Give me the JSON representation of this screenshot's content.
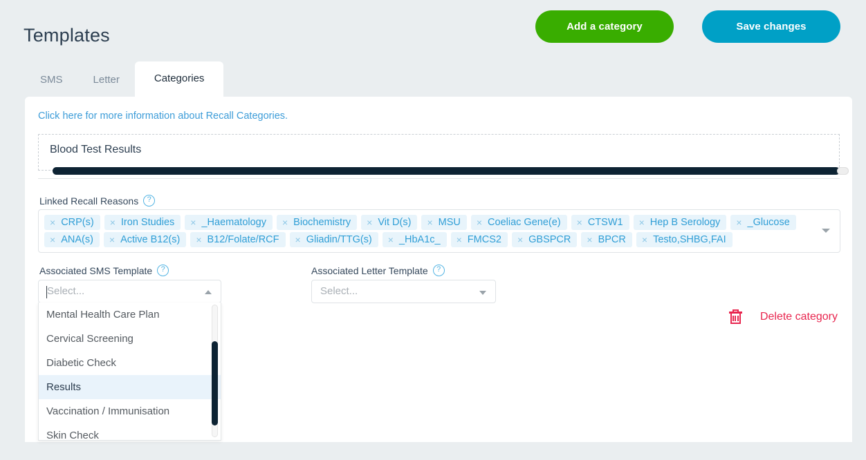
{
  "header": {
    "title": "Templates",
    "buttons": [
      {
        "label": "Add a category",
        "color": "#39ad00"
      },
      {
        "label": "Save changes",
        "color": "#00a0c6"
      }
    ]
  },
  "tabs": [
    {
      "label": "SMS",
      "active": false
    },
    {
      "label": "Letter",
      "active": false
    },
    {
      "label": "Categories",
      "active": true
    }
  ],
  "card": {
    "info_link": "Click here for more information about Recall Categories.",
    "category_name": "Blood Test Results",
    "recall": {
      "label": "Linked Recall Reasons",
      "help": "?",
      "chips": [
        "CRP(s)",
        "Iron Studies",
        "_Haematology",
        "Biochemistry",
        "Vit D(s)",
        "MSU",
        "Coeliac Gene(e)",
        "CTSW1",
        "Hep B Serology",
        "_Glucose",
        "ANA(s)",
        "Active B12(s)",
        "B12/Folate/RCF",
        "Gliadin/TTG(s)",
        "_HbA1c_",
        "FMCS2",
        "GBSPCR",
        "BPCR",
        "Testo,SHBG,FAI"
      ],
      "remove_glyph": "×"
    },
    "sms_template": {
      "label": "Associated SMS Template",
      "help": "?",
      "placeholder": "Select...",
      "value": "",
      "open": true,
      "options": [
        {
          "label": "Mental Health Care Plan",
          "selected": false
        },
        {
          "label": "Cervical Screening",
          "selected": false
        },
        {
          "label": "Diabetic Check",
          "selected": false
        },
        {
          "label": "Results",
          "selected": true
        },
        {
          "label": "Vaccination / Immunisation",
          "selected": false
        },
        {
          "label": "Skin Check",
          "selected": false
        }
      ]
    },
    "letter_template": {
      "label": "Associated Letter Template",
      "help": "?",
      "placeholder": "Select...",
      "value": "",
      "open": false
    },
    "delete": {
      "label": "Delete category",
      "color": "#e8254e"
    }
  }
}
